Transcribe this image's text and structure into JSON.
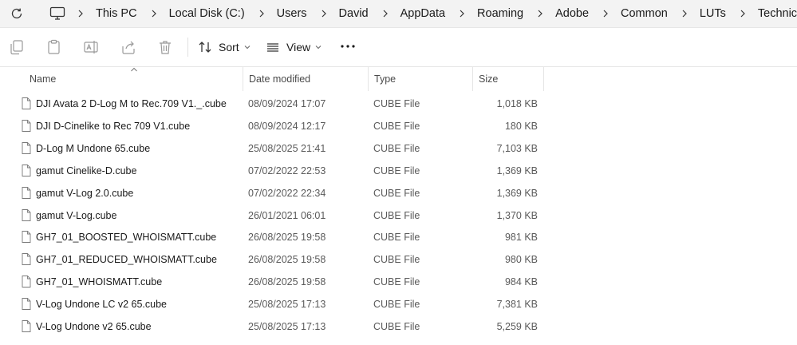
{
  "breadcrumb": [
    "This PC",
    "Local Disk (C:)",
    "Users",
    "David",
    "AppData",
    "Roaming",
    "Adobe",
    "Common",
    "LUTs",
    "Technical"
  ],
  "toolbar": {
    "sort_label": "Sort",
    "view_label": "View"
  },
  "columns": {
    "name": "Name",
    "date": "Date modified",
    "type": "Type",
    "size": "Size"
  },
  "files": [
    {
      "name": "DJI Avata 2 D-Log M to Rec.709 V1._.cube",
      "date": "08/09/2024 17:07",
      "type": "CUBE File",
      "size": "1,018 KB"
    },
    {
      "name": "DJI D-Cinelike to Rec 709 V1.cube",
      "date": "08/09/2024 12:17",
      "type": "CUBE File",
      "size": "180 KB"
    },
    {
      "name": "D-Log M Undone 65.cube",
      "date": "25/08/2025 21:41",
      "type": "CUBE File",
      "size": "7,103 KB"
    },
    {
      "name": "gamut Cinelike-D.cube",
      "date": "07/02/2022 22:53",
      "type": "CUBE File",
      "size": "1,369 KB"
    },
    {
      "name": "gamut V-Log 2.0.cube",
      "date": "07/02/2022 22:34",
      "type": "CUBE File",
      "size": "1,369 KB"
    },
    {
      "name": "gamut V-Log.cube",
      "date": "26/01/2021 06:01",
      "type": "CUBE File",
      "size": "1,370 KB"
    },
    {
      "name": "GH7_01_BOOSTED_WHOISMATT.cube",
      "date": "26/08/2025 19:58",
      "type": "CUBE File",
      "size": "981 KB"
    },
    {
      "name": "GH7_01_REDUCED_WHOISMATT.cube",
      "date": "26/08/2025 19:58",
      "type": "CUBE File",
      "size": "980 KB"
    },
    {
      "name": "GH7_01_WHOISMATT.cube",
      "date": "26/08/2025 19:58",
      "type": "CUBE File",
      "size": "984 KB"
    },
    {
      "name": "V-Log Undone LC v2 65.cube",
      "date": "25/08/2025 17:13",
      "type": "CUBE File",
      "size": "7,381 KB"
    },
    {
      "name": "V-Log Undone v2 65.cube",
      "date": "25/08/2025 17:13",
      "type": "CUBE File",
      "size": "5,259 KB"
    }
  ]
}
